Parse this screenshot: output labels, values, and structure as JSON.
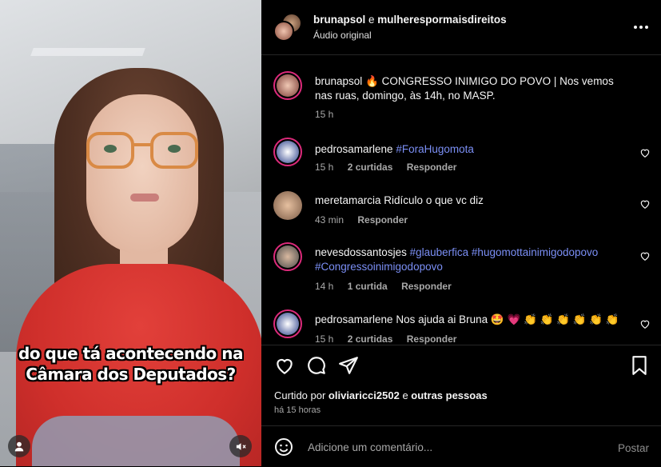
{
  "video": {
    "caption_line1": "do que tá acontecendo na",
    "caption_line2": "Câmara dos Deputados?"
  },
  "header": {
    "user1": "brunapsol",
    "conj": " e ",
    "user2": "mulherespormaisdireitos",
    "audio": "Áudio original"
  },
  "comments": [
    {
      "username": "brunapsol",
      "emoji": "🔥",
      "text": "CONGRESSO INIMIGO DO POVO | Nos vemos nas ruas, domingo, às 14h, no MASP.",
      "time": "15 h"
    },
    {
      "username": "pedrosamarlene",
      "tag": "#ForaHugomota",
      "time": "15 h",
      "likes": "2 curtidas",
      "reply": "Responder"
    },
    {
      "username": "meretamarcia",
      "text": "Ridículo o que vc diz",
      "time": "43 min",
      "reply": "Responder"
    },
    {
      "username": "nevesdossantosjes",
      "tag1": "#glauberfica",
      "tag2": "#hugomottainimigodopovo",
      "tag3": "#Congressoinimigodopovo",
      "time": "14 h",
      "likes": "1 curtida",
      "reply": "Responder"
    },
    {
      "username": "pedrosamarlene",
      "text": "Nos ajuda ai Bruna 🤩 💗 👏 👏 👏 👏 👏 👏",
      "time": "15 h",
      "likes": "2 curtidas",
      "reply": "Responder"
    }
  ],
  "footer": {
    "liked_prefix": "Curtido por ",
    "liked_user": "oliviaricci2502",
    "liked_mid": " e ",
    "liked_rest": "outras pessoas",
    "ago": "há 15 horas",
    "comment_placeholder": "Adicione um comentário...",
    "post_label": "Postar"
  },
  "colors": {
    "background": "#000000",
    "hashtag": "#7b8ff5",
    "muted": "#a8a8a8",
    "ring": "#dd2a7b"
  }
}
